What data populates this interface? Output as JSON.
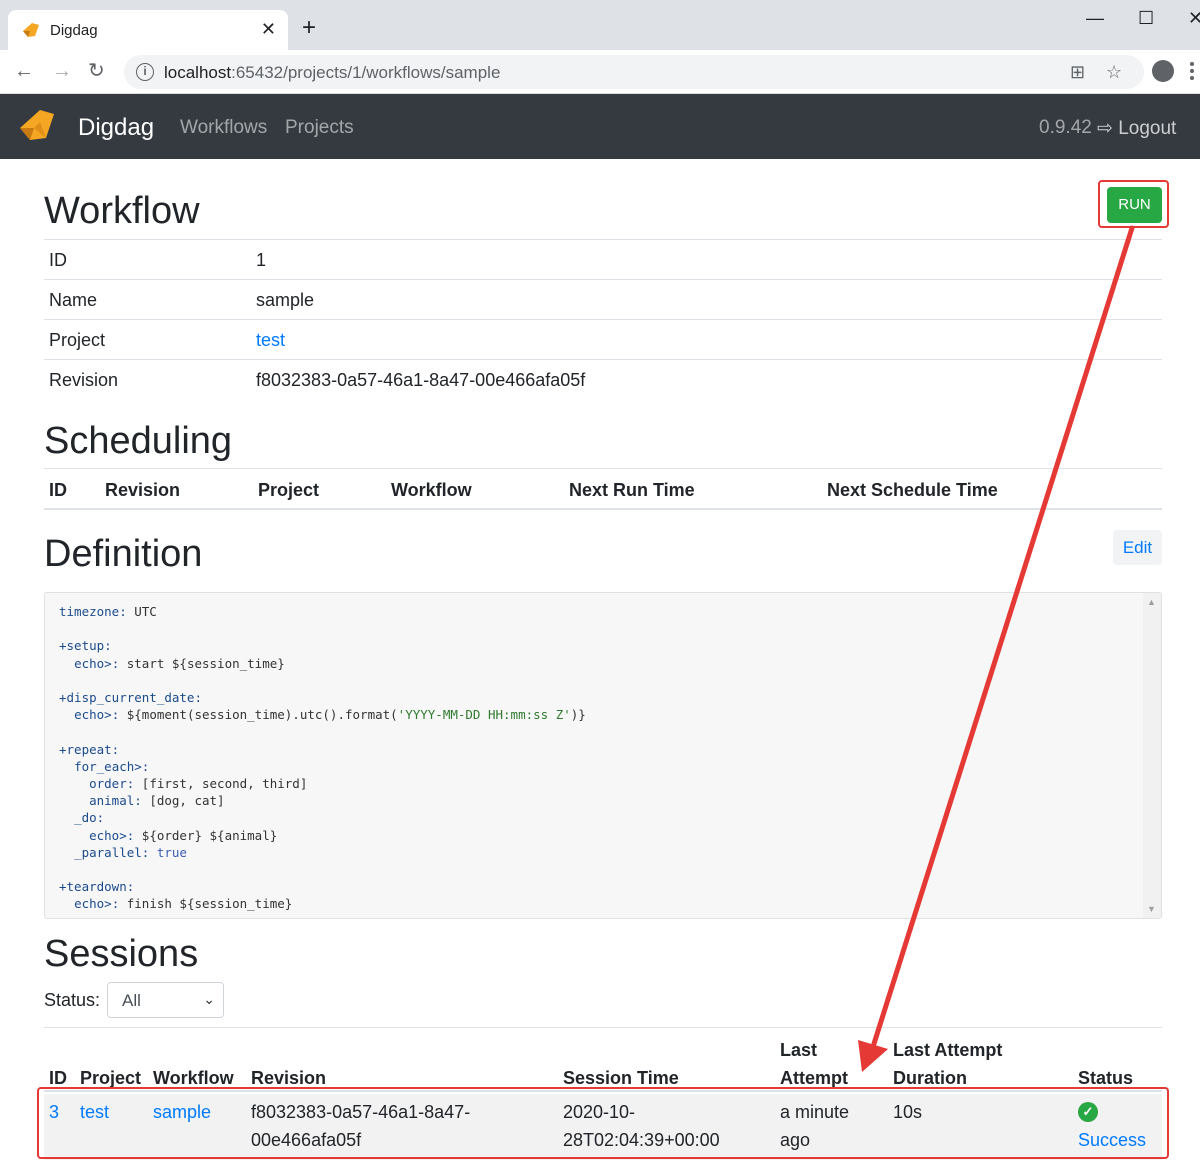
{
  "browser": {
    "tab_title": "Digdag",
    "url_host": "localhost",
    "url_rest": ":65432/projects/1/workflows/sample"
  },
  "navbar": {
    "brand": "Digdag",
    "links": [
      "Workflows",
      "Projects"
    ],
    "version": "0.9.42",
    "logout": "Logout"
  },
  "workflow": {
    "title": "Workflow",
    "run_label": "RUN",
    "rows": [
      {
        "key": "ID",
        "value": "1"
      },
      {
        "key": "Name",
        "value": "sample"
      },
      {
        "key": "Project",
        "value": "test"
      },
      {
        "key": "Revision",
        "value": "f8032383-0a57-46a1-8a47-00e466afa05f"
      }
    ]
  },
  "scheduling": {
    "title": "Scheduling",
    "columns": [
      "ID",
      "Revision",
      "Project",
      "Workflow",
      "Next Run Time",
      "Next Schedule Time"
    ]
  },
  "definition": {
    "title": "Definition",
    "edit_label": "Edit"
  },
  "sessions": {
    "title": "Sessions",
    "status_label": "Status:",
    "status_selected": "All",
    "columns": {
      "id": "ID",
      "project": "Project",
      "workflow": "Workflow",
      "revision": "Revision",
      "session_time": "Session Time",
      "last_attempt_1": "Last",
      "last_attempt_2": "Attempt",
      "last_duration_1": "Last Attempt",
      "last_duration_2": "Duration",
      "status": "Status"
    },
    "rows": [
      {
        "id": "3",
        "project": "test",
        "workflow": "sample",
        "revision_1": "f8032383-0a57-46a1-8a47-",
        "revision_2": "00e466afa05f",
        "session_time_1": "2020-10-",
        "session_time_2": "28T02:04:39+00:00",
        "last_attempt_1": "a minute",
        "last_attempt_2": "ago",
        "duration": "10s",
        "status": "Success"
      }
    ]
  },
  "colors": {
    "navbar": "#343a40",
    "run": "#28a745",
    "link": "#007bff",
    "annotation": "#e53935"
  }
}
